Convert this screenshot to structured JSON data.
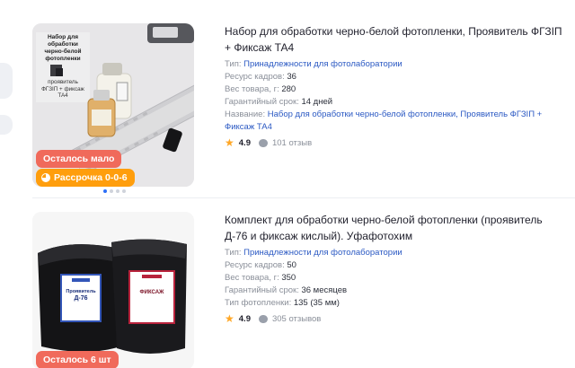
{
  "products": [
    {
      "title": "Набор для обработки черно-белой фотопленки, Проявитель ФГЗIП + Фиксаж ТА4",
      "image_caption": [
        "Набор для обработки",
        "черно-белой",
        "фотопленки",
        "проявитель",
        "ФГЗIП + фиксаж",
        "ТА4"
      ],
      "badges": {
        "stock": "Осталось мало",
        "installment": "Рассрочка 0-0-6"
      },
      "attrs": [
        {
          "label": "Тип:",
          "value": "Принадлежности для фотолаборатории"
        },
        {
          "label": "Ресурс кадров:",
          "value": "36"
        },
        {
          "label": "Вес товара, г:",
          "value": "280"
        },
        {
          "label": "Гарантийный срок:",
          "value": "14 дней"
        },
        {
          "label": "Название:",
          "value": "Набор для обработки черно-белой фотопленки, Проявитель ФГЗIП + Фиксаж ТА4"
        }
      ],
      "rating": "4.9",
      "reviews": "101 отзыв"
    },
    {
      "title": "Комплект для обработки черно-белой фотопленки (проявитель Д-76 и фиксаж кислый). Уфафотохим",
      "image_labels": [
        "Проявитель",
        "Д-76",
        "ФИКСАЖ"
      ],
      "badges": {
        "stock": "Осталось 6 шт"
      },
      "attrs": [
        {
          "label": "Тип:",
          "value": "Принадлежности для фотолаборатории"
        },
        {
          "label": "Ресурс кадров:",
          "value": "50"
        },
        {
          "label": "Вес товара, г:",
          "value": "350"
        },
        {
          "label": "Гарантийный срок:",
          "value": "36 месяцев"
        },
        {
          "label": "Тип фотопленки:",
          "value": "135 (35 мм)"
        }
      ],
      "rating": "4.9",
      "reviews": "305 отзывов"
    }
  ],
  "colors": {
    "accent": "#2b59c3",
    "stock_badge": "#f06a5b",
    "installment_badge": "#ff9e0d",
    "star": "#ffa726"
  }
}
